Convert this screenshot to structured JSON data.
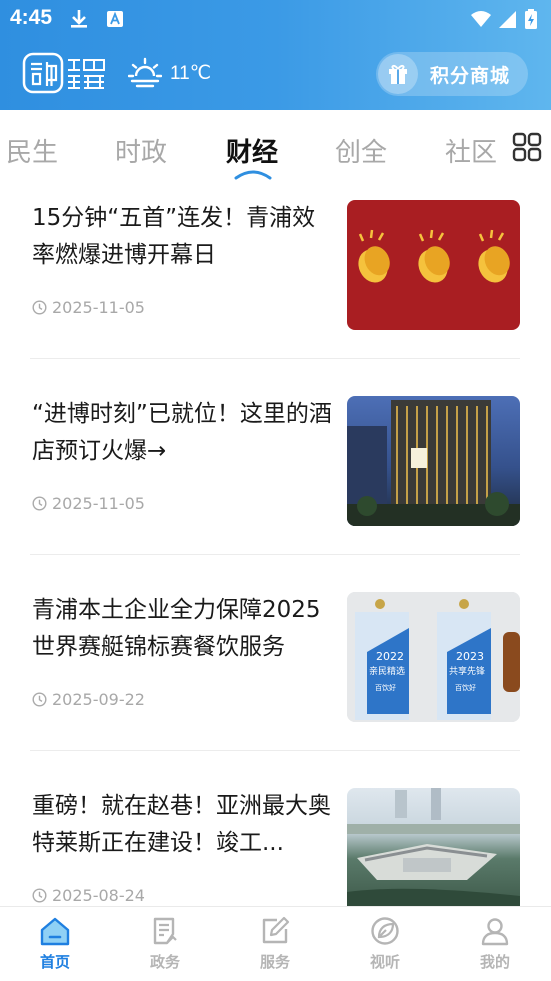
{
  "status_bar": {
    "time": "4:45"
  },
  "header": {
    "weather": {
      "temperature": "11℃",
      "icon": "partly-sunny-icon"
    },
    "mall_button": {
      "label": "积分商城",
      "icon": "gift-icon"
    },
    "logo_text": "融 绿色青浦"
  },
  "tabs": {
    "items": [
      {
        "label": "民生"
      },
      {
        "label": "时政"
      },
      {
        "label": "财经"
      },
      {
        "label": "创全"
      },
      {
        "label": "社区"
      }
    ],
    "active_index": 2
  },
  "news": [
    {
      "title": "15分钟“五首”连发！青浦效率燃爆进博开幕日",
      "date": "2025-11-05",
      "thumb": "clapping-hands"
    },
    {
      "title": "“进博时刻”已就位！这里的酒店预订火爆→",
      "date": "2025-11-05",
      "thumb": "hotel-night"
    },
    {
      "title": "青浦本土企业全力保障2025世界赛艇锦标赛餐饮服务",
      "date": "2025-09-22",
      "thumb": "award-plaques",
      "plaques": [
        {
          "year": "2022",
          "text": "亲民精选",
          "sub": "百饮好"
        },
        {
          "year": "2023",
          "text": "共享先锋",
          "sub": "百饮好"
        }
      ]
    },
    {
      "title": "重磅！就在赵巷！亚洲最大奥特莱斯正在建设！竣工...",
      "date": "2025-08-24",
      "thumb": "aerial-construction"
    }
  ],
  "bottom_nav": {
    "items": [
      {
        "label": "首页",
        "icon": "home-icon"
      },
      {
        "label": "政务",
        "icon": "document-icon"
      },
      {
        "label": "服务",
        "icon": "edit-icon"
      },
      {
        "label": "视听",
        "icon": "leaf-icon"
      },
      {
        "label": "我的",
        "icon": "user-icon"
      }
    ],
    "active_index": 0
  },
  "colors": {
    "accent": "#1f7fe0",
    "header_start": "#2f8fe0",
    "header_end": "#5fb6ee",
    "inactive": "#a8a8a8"
  }
}
